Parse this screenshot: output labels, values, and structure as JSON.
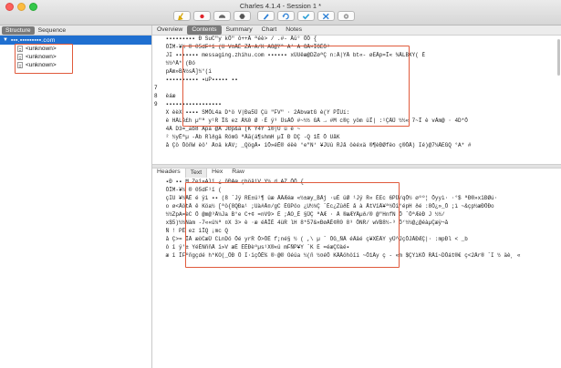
{
  "window": {
    "title": "Charles 4.1.4 - Session 1 *"
  },
  "toolbar": {
    "buttons": [
      {
        "name": "broom-icon",
        "color": "#d5a300"
      },
      {
        "name": "record-icon",
        "color": "#e0242b"
      },
      {
        "name": "throttle-icon",
        "color": "#666666"
      },
      {
        "name": "breakpoint-icon",
        "color": "#555555"
      },
      {
        "name": "compose-pen-icon",
        "color": "#2a7fd6"
      },
      {
        "name": "repeat-icon",
        "color": "#2a7fd6"
      },
      {
        "name": "validate-check-icon",
        "color": "#2a9fd6"
      },
      {
        "name": "tools-icon",
        "color": "#2a7fd6"
      },
      {
        "name": "settings-gear-icon",
        "color": "#888888"
      }
    ]
  },
  "left": {
    "tabs": [
      "Structure",
      "Sequence"
    ],
    "host": "▪▪▪.▪▪▪▪▪▪▪▪▪.com",
    "children": [
      "<unknown>",
      "<unknown>",
      "<unknown>"
    ]
  },
  "right": {
    "tabs": [
      "Overview",
      "Contents",
      "Summary",
      "Chart",
      "Notes"
    ],
    "upper_rows": [
      {
        "ln": "",
        "text": "         ▪▪▪▪▪▪▪▪▪  Ð SuC\"y kÕ\"   ô++Å   ªéè>   / .#- Åû° ÕÖ {"
      },
      {
        "ln": "",
        "text": "  ÕÎM-¥½   ®  05dF¹ï   (Ú  V¤ÅÈ ZÅ+A/K AÒ@Ýª A' A  ÓÅ×ÏÒÈÔ³"
      },
      {
        "ln": "",
        "text": "  JI  ▪▪▪▪▪▪▪  messaging.zhihu.com  ▪▪▪▪▪▪   xÛUêæ@DZøªÇ    n:Â|YÅ  bt«-      øEÅp=Î«    ¾ÅLBXY(  É"
      },
      {
        "ln": "",
        "text": "  ½½^Å* (Ðó"
      },
      {
        "ln": "",
        "text": "  pÃm»BA½sÃ]½°(i"
      },
      {
        "ln": "",
        "text": "              ▪▪▪▪▪▪▪▪▪▪  ▪uP▪▪▪▪▪  ▪▪"
      },
      {
        "ln": "7",
        "text": ""
      },
      {
        "ln": "8",
        "text": "  èáæ"
      },
      {
        "ln": "9",
        "text": "  ▪▪▪▪▪▪▪▪▪▪▪▪▪▪▪▪▪"
      },
      {
        "ln": "",
        "text": "  X  èèX    ▪▪▪▪   SMÕL4a    D*ö V|Ða5Ü   Çü   \"FV\" · 2ÀbvætG     è(Y    PÎUí:"
      },
      {
        "ln": "",
        "text": "  è  HÄLê£h  µ\"ª   y¹R   Îß ez Å%0  Ø ·È  ÿ³   ÜsÄÕ  #~½½  GÄ   →  #M    c®ç    yöm    üÏ|  :¹ÇÄÜ  ½½«  7~Î   è   vÅm@ · 4D*Õ"
      },
      {
        "ln": "",
        "text": "  4Å   D3=_ab8   Âpà @Å JÐp&ä (K Y4Y ï®|Ú  ü  è  ~"
      },
      {
        "ln": "",
        "text": "  ²  ½yÊªµ -Åb   Rlðgä   RömG ªÅã(ä¶shmH  µÎ  Ð  DÇ   -Q  1Ê  Õ UåK"
      },
      {
        "ln": "",
        "text": "  å Çö     ÕöñW  èö'  Å¤ä kÄV; _QögÅ▪  îÕ»éË®   éëè  °e\"N‘   ¥JUû    RJå  öèéxä ®¶èÐØfëo ç®ÕÄ)   Ié)@7¼ÄEGQ  °A* #"
      }
    ],
    "subtabs": [
      "Headers",
      "Text",
      "Hex",
      "Raw"
    ],
    "lower_rows": [
      {
        "ln": "",
        "text": "       ▪Ð  ▪▪  M  Zeî»Alî     ¿ ñÐAæ çböâiV     Y¼ d AZ ÕÖ {"
      },
      {
        "ln": "",
        "text": "  ÕÎM-¥½   ®   05dF¹ï       ("
      },
      {
        "ln": "",
        "text": "  çIU  ¥½ÅË é  ÿì   ▪▪  (8 ˆJÿ  RE±ü¹¶ ûæ  ÅÄÆéæ  «½±æy_BÄj   ·uÉ   üØ  ¹Jÿ  R«  ÉEc  6PÜ/qÕ½  øºº¦ Õyyì·   ·°$  ªÐ®»xîÐØú·"
      },
      {
        "ln": "",
        "text": "  o      ø<ÅötÄ ê  Köa½  [ªö{8QÐa¹  ;Uà#Å¤/gC  ÉGPöo   ¿U½¼Ç  ˆÉc¿ZûðÉ    å à   ÂtVîÄ¥ª½Õî°épH  ðé :8Õ¿»_Õ ;ì   ~&çp½æÐÕÐo"
      },
      {
        "ln": "",
        "text": "  ½½ZpA=èC Õ  @m@³Ä¼Ja  B°e  C+¢ =nV9> É  ;ÅO_É  §ÜÇ   ªÀÆ   · Å   ®æÆYÅµð/®  @\"HnfN  Õ  ˆÖªÆèÐ  J ½½/"
      },
      {
        "ln": "",
        "text": "  x$5)½½Nàm  -7««ü¼ª   ¤X   3> è ·æ    éÅÎÈ 4üR  lH 8*57&«ÐøÅÈ¢R0  8³ ÕNR/  wVB8½-³ Ö‘½½@¿@éàµÇæÿ¬å"
      },
      {
        "ln": "",
        "text": "  Ñ  !  PÊ   ez îÎQ ¡mc Q"
      },
      {
        "ln": "",
        "text": "  å    Ç>= ÎÅ  æöCæÜ CLnDö Õé yrR  Õ>ÕÉ f;né§  ½ (  ,\\   µ ˆ ÕG_ÑÂ éÄâé    ç¥XÉÄY yÜ^JçÕJÅÐÆÇ|·    :mpÐl  <    _b"
      },
      {
        "ln": "",
        "text": "  ô  î     ÿ'±   YéÉNññÂ  î»V  æÉ  ÉÊÐèºµs¹X®«ü  mFÑP¥Y  ˆK  E  =éæÇ©àé▪"
      },
      {
        "ln": "",
        "text": "  æ  î  ÎFºñgçdé h*KO(_ÕÐ  Õ I·îçÕÉ%  ®·@® Oéüa  ½(ñ ½¤éÕ  KÃÂöhöîí   ~Õ1Äy ç    - «m $ÇYìKÕ RÅî~DÕát®€   ç<2Är®  ˆI  ½  äè¸ «"
      }
    ]
  }
}
